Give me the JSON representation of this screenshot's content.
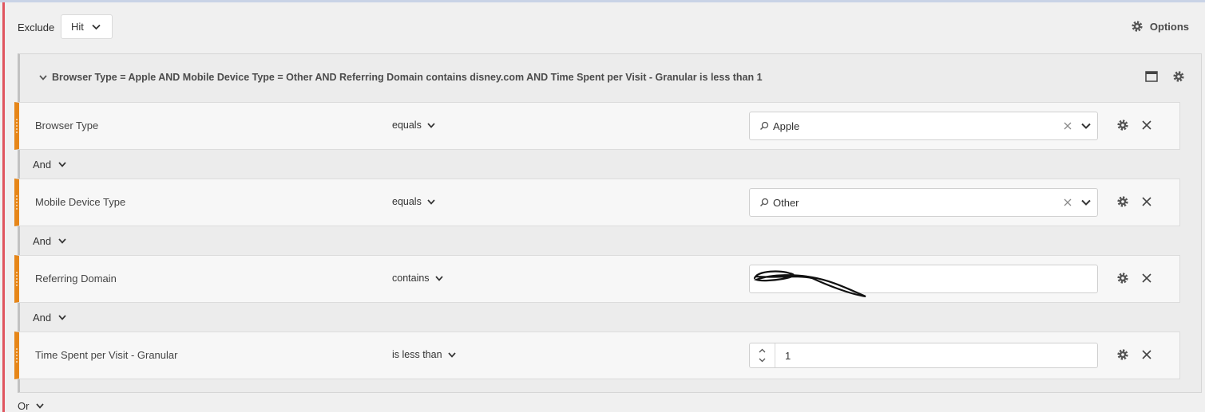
{
  "header": {
    "mode_label": "Exclude",
    "scope_value": "Hit",
    "options_label": "Options"
  },
  "container": {
    "summary": "Browser Type = Apple AND Mobile Device Type = Other AND Referring Domain contains disney.com AND Time Spent per Visit - Granular is less than 1"
  },
  "rules": [
    {
      "dimension": "Browser Type",
      "operator": "equals",
      "value": "Apple"
    },
    {
      "dimension": "Mobile Device Type",
      "operator": "equals",
      "value": "Other"
    },
    {
      "dimension": "Referring Domain",
      "operator": "contains",
      "value": ""
    },
    {
      "dimension": "Time Spent per Visit - Granular",
      "operator": "is less than",
      "value": "1"
    }
  ],
  "logic": {
    "and_label": "And",
    "or_label": "Or"
  },
  "colors": {
    "accent": "#e68619",
    "exclude_bar": "#e0555f"
  }
}
